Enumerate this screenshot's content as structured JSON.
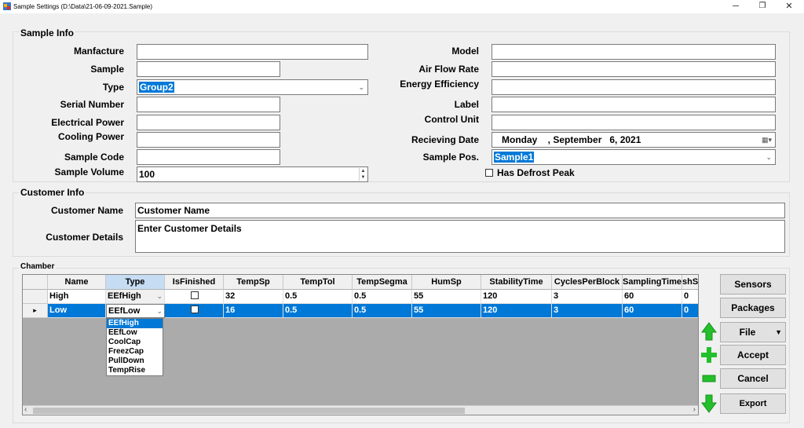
{
  "window": {
    "title": "Sample Settings (D:\\Data\\21-06-09-2021.Sample)",
    "minimize": "─",
    "maximize": "❐",
    "close": "✕"
  },
  "sample_info": {
    "group_label": "Sample Info",
    "manufacture_label": "Manfacture",
    "manufacture_value": "",
    "sample_label": "Sample",
    "sample_value": "",
    "type_label": "Type",
    "type_value": "Group2",
    "serial_label": "Serial Number",
    "serial_value": "",
    "elec_label": "Electrical Power",
    "elec_value": "",
    "cooling_label": "Cooling Power",
    "cooling_value": "",
    "code_label": "Sample Code",
    "code_value": "",
    "volume_label": "Sample Volume",
    "volume_value": "100",
    "model_label": "Model",
    "model_value": "",
    "airflow_label": "Air Flow Rate",
    "airflow_value": "",
    "energy_label": "Energy Efficiency",
    "energy_value": "",
    "label_label": "Label",
    "label_value": "",
    "control_label": "Control Unit",
    "control_value": "",
    "receiving_label": "Recieving Date",
    "receiving_value": "Monday    , September   6, 2021",
    "pos_label": "Sample Pos.",
    "pos_value": "Sample1",
    "defrost_label": "Has Defrost Peak"
  },
  "customer_info": {
    "group_label": "Customer Info",
    "name_label": "Customer Name",
    "name_value": "Customer Name",
    "details_label": "Customer Details",
    "details_value": "Enter Customer Details"
  },
  "chamber": {
    "group_label": "Chamber",
    "columns": [
      "Name",
      "Type",
      "IsFinished",
      "TempSp",
      "TempTol",
      "TempSegma",
      "HumSp",
      "StabilityTime",
      "CyclesPerBlock",
      "SamplingTime",
      "shS"
    ],
    "rows": [
      {
        "name": "High",
        "type": "EEfHigh",
        "temp_sp": "32",
        "temp_tol": "0.5",
        "temp_segma": "0.5",
        "hum_sp": "55",
        "stability": "120",
        "cycles": "3",
        "sampling": "60",
        "shs": "0"
      },
      {
        "name": "Low",
        "type": "EEfLow",
        "temp_sp": "16",
        "temp_tol": "0.5",
        "temp_segma": "0.5",
        "hum_sp": "55",
        "stability": "120",
        "cycles": "3",
        "sampling": "60",
        "shs": "0"
      }
    ],
    "row_pointer": "▸",
    "dropdown_options": [
      "EEfHigh",
      "EEfLow",
      "CoolCap",
      "FreezCap",
      "PullDown",
      "TempRise"
    ]
  },
  "buttons": {
    "sensors": "Sensors",
    "packages": "Packages",
    "file": "File",
    "accept": "Accept",
    "cancel": "Cancel",
    "export": "Export"
  },
  "colors": {
    "accent": "#0078d7",
    "green": "#22c02a"
  }
}
